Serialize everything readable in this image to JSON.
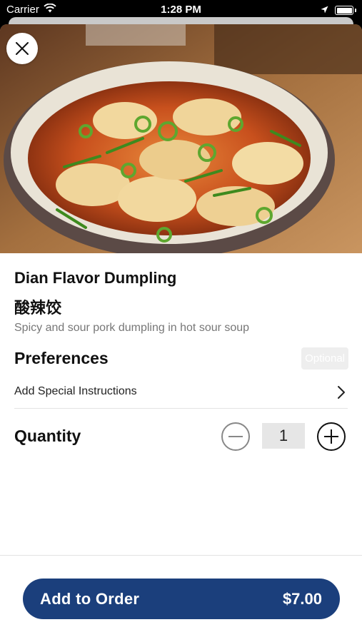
{
  "status_bar": {
    "carrier": "Carrier",
    "time": "1:28 PM"
  },
  "hero": {
    "image_description_icon": "dumpling-soup-photo"
  },
  "item": {
    "name": "Dian Flavor Dumpling",
    "name_chinese": "酸辣饺",
    "description": "Spicy and sour pork dumpling in hot sour soup"
  },
  "preferences": {
    "heading": "Preferences",
    "badge": "Optional",
    "special_instructions_label": "Add Special Instructions"
  },
  "quantity": {
    "label": "Quantity",
    "value": "1"
  },
  "footer": {
    "add_label": "Add to Order",
    "price": "$7.00"
  },
  "colors": {
    "accent": "#1b3f7c",
    "background": "#ffffff"
  }
}
